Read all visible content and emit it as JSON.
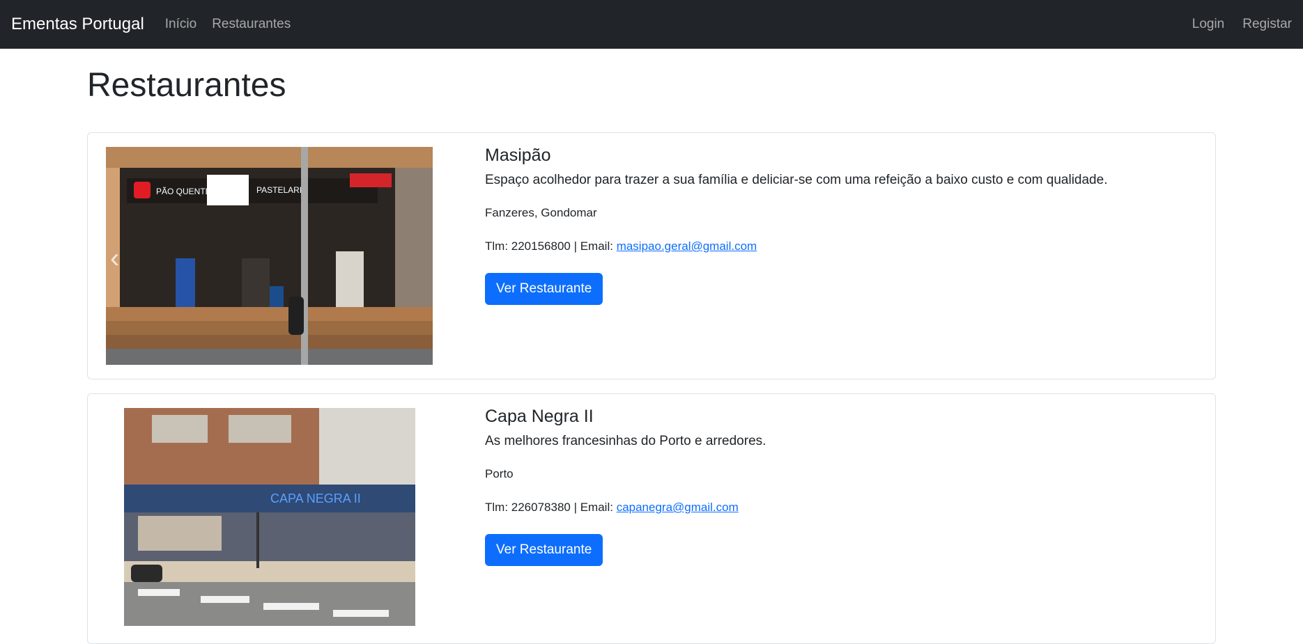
{
  "navbar": {
    "brand": "Ementas Portugal",
    "links": [
      "Início",
      "Restaurantes"
    ],
    "right_links": [
      "Login",
      "Registar"
    ]
  },
  "page": {
    "title": "Restaurantes"
  },
  "restaurants": [
    {
      "name": "Masipão",
      "description": "Espaço acolhedor para trazer a sua família e deliciar-se com uma refeição a baixo custo e com qualidade.",
      "location": "Fanzeres, Gondomar",
      "contact_prefix": "Tlm: 220156800 | Email: ",
      "email": "masipao.geral@gmail.com",
      "button": "Ver Restaurante",
      "sign_text": "PÃO QUENTE",
      "sign_text_2": "PASTELARIA"
    },
    {
      "name": "Capa Negra II",
      "description": "As melhores francesinhas do Porto e arredores.",
      "location": "Porto",
      "contact_prefix": "Tlm: 226078380 | Email: ",
      "email": "capanegra@gmail.com",
      "button": "Ver Restaurante",
      "sign_text": "CAPA NEGRA II"
    }
  ],
  "colors": {
    "navbar_bg": "#212529",
    "primary": "#0d6efd",
    "card_border": "#dee2e6"
  }
}
